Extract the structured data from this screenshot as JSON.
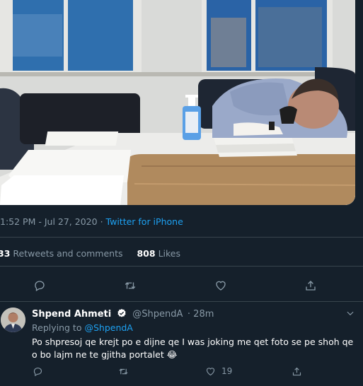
{
  "tweet": {
    "time": "1:52 PM",
    "date": "Jul 27, 2020",
    "separator": "·",
    "source": "Twitter for iPhone",
    "retweets_count": "33",
    "retweets_label": "Retweets and comments",
    "likes_count": "808",
    "likes_label": "Likes"
  },
  "reply": {
    "display_name": "Shpend Ahmeti",
    "handle": "@ShpendA",
    "time_ago": "· 28m",
    "replying_label": "Replying to",
    "replying_to": "@ShpendA",
    "text": "Po shpresoj qe krejt po e dijne qe I was joking me qet foto se pe shoh qe o bo lajm ne te gjitha portalet",
    "emoji": "😂",
    "like_count": "19"
  },
  "icons": {
    "reply": "reply-icon",
    "retweet": "retweet-icon",
    "like": "heart-icon",
    "share": "share-icon",
    "verified": "verified-badge-icon",
    "more": "chevron-down-icon"
  },
  "colors": {
    "background": "#15202b",
    "accent": "#1da1f2",
    "muted": "#8899a6",
    "divider": "#38444d"
  }
}
